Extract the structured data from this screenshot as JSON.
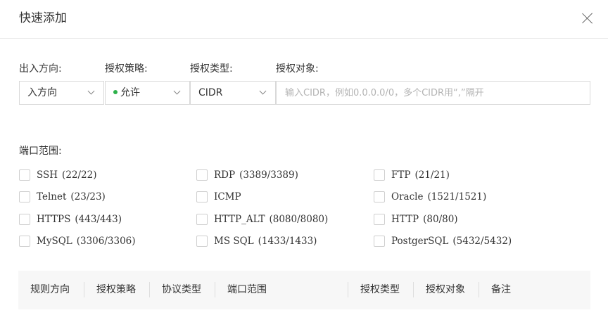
{
  "dialog": {
    "title": "快速添加"
  },
  "form": {
    "direction": {
      "label": "出入方向:",
      "value": "入方向"
    },
    "policy": {
      "label": "授权策略:",
      "value": "允许",
      "status_color": "#2db14a"
    },
    "auth_type": {
      "label": "授权类型:",
      "value": "CIDR"
    },
    "auth_target": {
      "label": "授权对象:",
      "placeholder": "输入CIDR，例如0.0.0.0/0，多个CIDR用“,”隔开",
      "value": ""
    }
  },
  "ports": {
    "label": "端口范围:",
    "items": [
      {
        "name": "SSH",
        "range": "(22/22)",
        "checked": false
      },
      {
        "name": "RDP",
        "range": "(3389/3389)",
        "checked": false
      },
      {
        "name": "FTP",
        "range": "(21/21)",
        "checked": false
      },
      {
        "name": "Telnet",
        "range": "(23/23)",
        "checked": false
      },
      {
        "name": "ICMP",
        "range": "",
        "checked": false
      },
      {
        "name": "Oracle",
        "range": "(1521/1521)",
        "checked": false
      },
      {
        "name": "HTTPS",
        "range": "(443/443)",
        "checked": false
      },
      {
        "name": "HTTP_ALT",
        "range": "(8080/8080)",
        "checked": false
      },
      {
        "name": "HTTP",
        "range": "(80/80)",
        "checked": false
      },
      {
        "name": "MySQL",
        "range": "(3306/3306)",
        "checked": false
      },
      {
        "name": "MS SQL",
        "range": "(1433/1433)",
        "checked": false
      },
      {
        "name": "PostgerSQL",
        "range": "(5432/5432)",
        "checked": false
      }
    ]
  },
  "table": {
    "headers": [
      "规则方向",
      "授权策略",
      "协议类型",
      "端口范围",
      "授权类型",
      "授权对象",
      "备注"
    ]
  }
}
